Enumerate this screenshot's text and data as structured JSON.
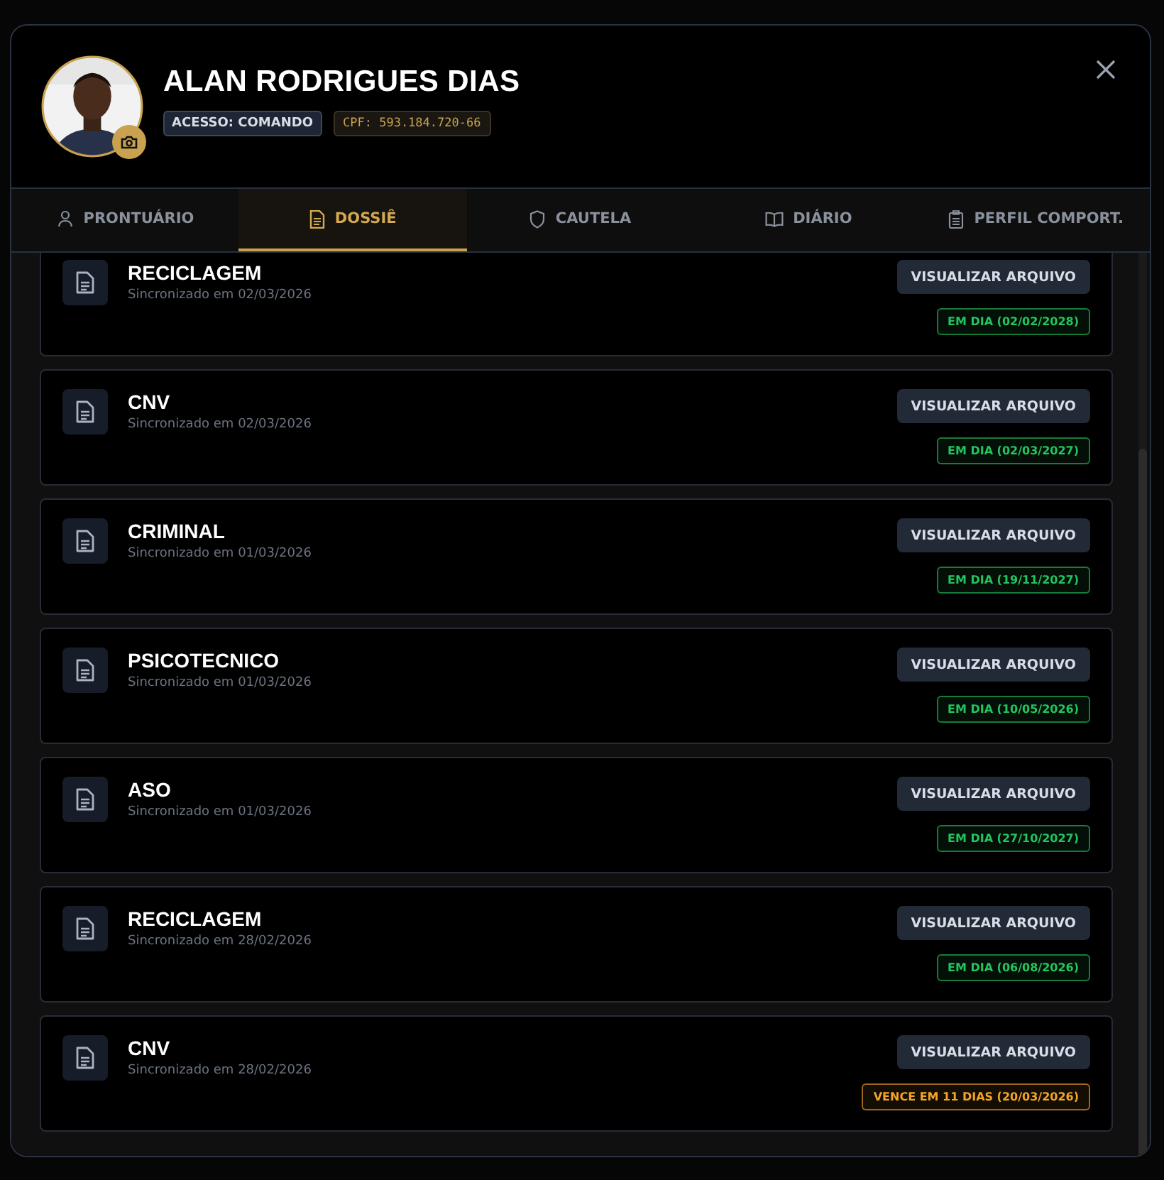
{
  "profile": {
    "name": "ALAN RODRIGUES DIAS",
    "access_badge": "ACESSO: COMANDO",
    "cpf_badge": "CPF: 593.184.720-66"
  },
  "tabs": [
    {
      "label": "PRONTUÁRIO",
      "selected": false
    },
    {
      "label": "DOSSIÊ",
      "selected": true
    },
    {
      "label": "CAUTELA",
      "selected": false
    },
    {
      "label": "DIÁRIO",
      "selected": false
    },
    {
      "label": "PERFIL COMPORT.",
      "selected": false
    }
  ],
  "documents": [
    {
      "title": "RECICLAGEM",
      "synced": "Sincronizado em 02/03/2026",
      "button": "VISUALIZAR ARQUIVO",
      "color": "#22c55e",
      "status_text": "EM DIA (02/02/2028)"
    },
    {
      "title": "CNV",
      "synced": "Sincronizado em 02/03/2026",
      "button": "VISUALIZAR ARQUIVO",
      "color": "#22c55e",
      "status_text": "EM DIA (02/03/2027)"
    },
    {
      "title": "CRIMINAL",
      "synced": "Sincronizado em 01/03/2026",
      "button": "VISUALIZAR ARQUIVO",
      "color": "#22c55e",
      "status_text": "EM DIA (19/11/2027)"
    },
    {
      "title": "PSICOTECNICO",
      "synced": "Sincronizado em 01/03/2026",
      "button": "VISUALIZAR ARQUIVO",
      "color": "#22c55e",
      "status_text": "EM DIA (10/05/2026)"
    },
    {
      "title": "ASO",
      "synced": "Sincronizado em 01/03/2026",
      "button": "VISUALIZAR ARQUIVO",
      "color": "#22c55e",
      "status_text": "EM DIA (27/10/2027)"
    },
    {
      "title": "RECICLAGEM",
      "synced": "Sincronizado em 28/02/2026",
      "button": "VISUALIZAR ARQUIVO",
      "color": "#22c55e",
      "status_text": "EM DIA (06/08/2026)"
    },
    {
      "title": "CNV",
      "synced": "Sincronizado em 28/02/2026",
      "button": "VISUALIZAR ARQUIVO",
      "color": "#f5a524",
      "status_text": "VENCE EM 11 DIAS (20/03/2026)"
    }
  ]
}
